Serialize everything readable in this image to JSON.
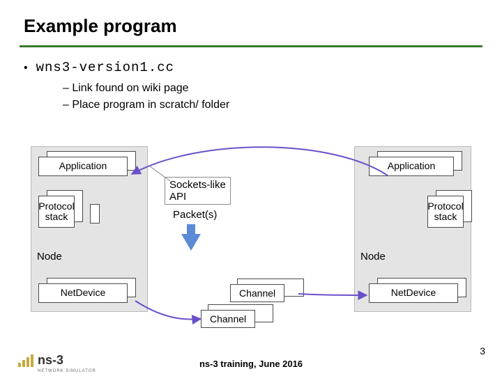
{
  "title": "Example program",
  "main_bullet": {
    "code": "wns3-version1.cc"
  },
  "sub_bullets": [
    "Link found on wiki page",
    "Place program in scratch/ folder"
  ],
  "diagram": {
    "node_label": "Node",
    "application": "Application",
    "protocol_stack": "Protocol\nstack",
    "netdevice": "NetDevice",
    "sockets_api": "Sockets-like\nAPI",
    "packets": "Packet(s)",
    "channel": "Channel"
  },
  "footer": "ns-3 training, June 2016",
  "page_number": "3",
  "logo": {
    "text": "ns-3",
    "subtitle": "NETWORK SIMULATOR"
  }
}
